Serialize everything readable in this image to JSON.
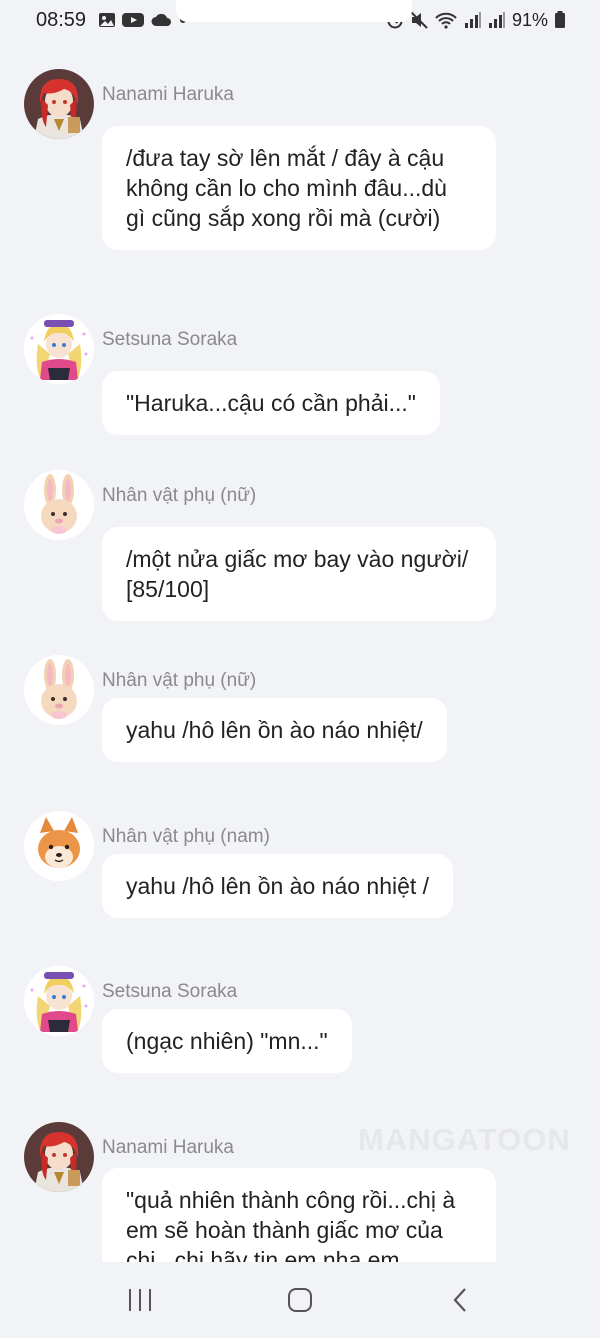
{
  "status_bar": {
    "time": "08:59",
    "battery_percent": "91%",
    "icons": [
      "gallery-icon",
      "youtube-icon",
      "cloud-icon",
      "dot-icon",
      "alarm-icon",
      "mute-icon",
      "wifi-icon",
      "signal-icon",
      "signal-icon",
      "battery-icon"
    ]
  },
  "chat": {
    "messages": [
      {
        "sender": "Nanami Haruka",
        "avatar": "nanami-avatar",
        "text": "/đưa tay sờ lên mắt / đây à cậu không cần lo cho mình đâu...dù gì cũng sắp xong rồi mà (cười)"
      },
      {
        "sender": "Setsuna Soraka",
        "avatar": "setsuna-avatar",
        "text": "\"Haruka...cậu có cần phải...\""
      },
      {
        "sender": "Nhân vật phụ (nữ)",
        "avatar": "bunny-avatar",
        "text": "/một nửa giấc mơ bay vào người/ [85/100]"
      },
      {
        "sender": "Nhân vật phụ (nữ)",
        "avatar": "bunny-avatar",
        "text": "yahu /hô lên ồn ào náo nhiệt/"
      },
      {
        "sender": "Nhân vật phụ (nam)",
        "avatar": "shiba-avatar",
        "text": "yahu /hô lên ồn ào náo nhiệt /"
      },
      {
        "sender": "Setsuna Soraka",
        "avatar": "setsuna-avatar",
        "text": "(ngạc nhiên) \"mn...\""
      },
      {
        "sender": "Nanami Haruka",
        "avatar": "nanami-avatar",
        "text": "\"quả nhiên thành công rồi...chị à em sẽ hoàn thành giấc mơ của chị...chị hãy tin em nha em"
      }
    ]
  },
  "watermark": "MANGATOON",
  "nav_bar": {
    "buttons": [
      "recent-apps-icon",
      "home-icon",
      "back-icon"
    ]
  }
}
